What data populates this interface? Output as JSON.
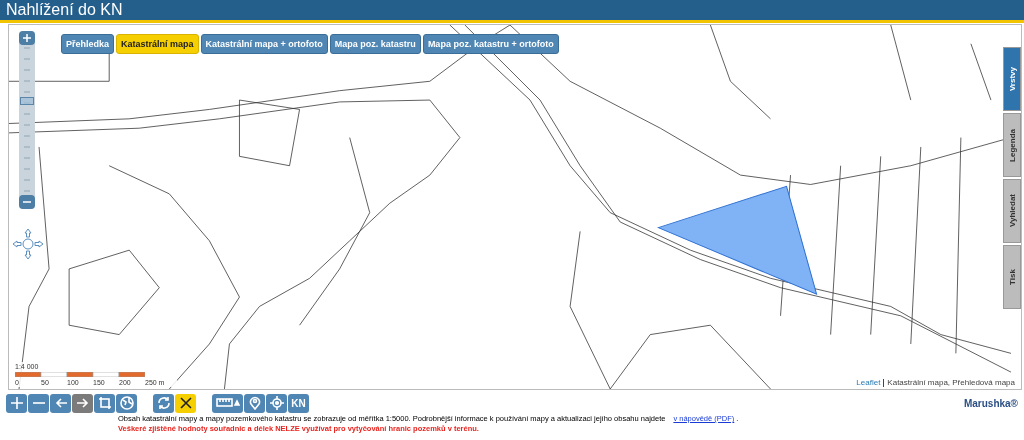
{
  "window": {
    "title": "Nahlížení do KN"
  },
  "map_tabs": [
    {
      "label": "Přehledka",
      "selected": false
    },
    {
      "label": "Katastrální mapa",
      "selected": true
    },
    {
      "label": "Katastrální mapa + ortofoto",
      "selected": false
    },
    {
      "label": "Mapa poz. katastru",
      "selected": false
    },
    {
      "label": "Mapa poz. katastru + ortofoto",
      "selected": false
    }
  ],
  "side_tabs": [
    {
      "label": "Vrstvy",
      "selected": true
    },
    {
      "label": "Legenda",
      "selected": false
    },
    {
      "label": "Vyhledat",
      "selected": false
    },
    {
      "label": "Tisk",
      "selected": false
    }
  ],
  "zoom_slider": {
    "level": 0.63
  },
  "scale": {
    "ratio": "1:4 000",
    "labels": [
      "0",
      "50",
      "100",
      "150",
      "200",
      "250 m"
    ]
  },
  "attribution": {
    "link": "Leaflet",
    "text": "Katastrální mapa, Přehledová mapa"
  },
  "toolbar": [
    {
      "selected": false,
      "disabled": false
    },
    {
      "selected": false,
      "disabled": false
    },
    {
      "selected": false,
      "disabled": false
    },
    {
      "selected": false,
      "disabled": true
    },
    {
      "selected": false,
      "disabled": false
    },
    {
      "selected": false,
      "disabled": false
    },
    {
      "selected": false,
      "disabled": false
    },
    {
      "selected": true,
      "disabled": false
    },
    {
      "selected": false,
      "disabled": false
    },
    {
      "selected": false,
      "disabled": false
    },
    {
      "selected": false,
      "disabled": false
    },
    {
      "selected": false,
      "disabled": false,
      "label": "KN"
    }
  ],
  "brand": "Marushka®",
  "footer": {
    "text": "Obsah katastrální mapy a mapy pozemkového katastru se zobrazuje od měřítka 1:5000. Podrobnější informace k používání mapy a aktualizaci jejího obsahu najdete",
    "link": "v nápovědě (PDF)",
    "separator": ".",
    "warning": "Veškeré zjištěné hodnoty souřadnic a délek NELZE využívat pro vytyčování hranic pozemků v terénu."
  }
}
